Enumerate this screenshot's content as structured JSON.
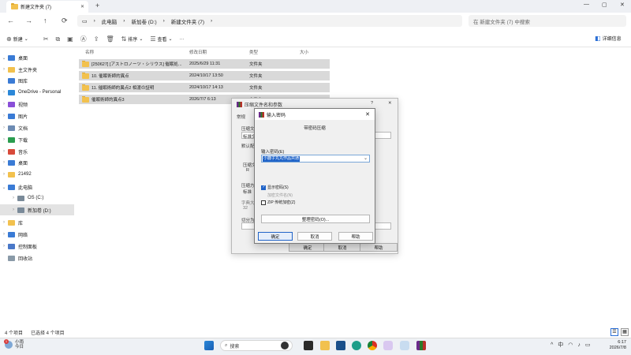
{
  "window": {
    "tab_title": "新建文件夹 (7)",
    "tab_close": "✕",
    "new_tab": "+",
    "min": "—",
    "max": "▢",
    "close": "✕"
  },
  "nav": {
    "back": "←",
    "forward": "→",
    "up": "↑",
    "refresh": "⟳",
    "breadcrumb": [
      "此电脑",
      "新加卷 (D:)",
      "新建文件夹 (7)"
    ],
    "search_placeholder": "在 新建文件夹 (7) 中搜索"
  },
  "toolbar": {
    "new_label": "新建",
    "sort_label": "排序",
    "view_label": "查看",
    "more_label": "···",
    "details_label": "详细信息"
  },
  "sidebar": {
    "items": [
      {
        "label": "桌面",
        "color": "#3a7bd5"
      },
      {
        "label": "主文件夹",
        "color": "#f2c14e"
      },
      {
        "label": "图库",
        "color": "#3a7bd5"
      },
      {
        "label": "OneDrive - Personal",
        "color": "#2b88d8"
      },
      {
        "label": "视频",
        "color": "#8a4fd8"
      },
      {
        "label": "图片",
        "color": "#3a7bd5"
      },
      {
        "label": "文档",
        "color": "#6d8bb3"
      },
      {
        "label": "下载",
        "color": "#2a9d4f"
      },
      {
        "label": "音乐",
        "color": "#d84a3a"
      },
      {
        "label": "桌面",
        "color": "#3a7bd5"
      },
      {
        "label": "21492",
        "color": "#f2c14e"
      },
      {
        "label": "此电脑",
        "color": "#3a7bd5"
      },
      {
        "label": "OS (C:)",
        "color": "#7a8a99"
      },
      {
        "label": "新加卷 (D:)",
        "color": "#7a8a99"
      },
      {
        "label": "库",
        "color": "#f2c14e"
      },
      {
        "label": "网络",
        "color": "#3a7bd5"
      },
      {
        "label": "控制面板",
        "color": "#4a78c8"
      },
      {
        "label": "回收站",
        "color": "#8a9aa8"
      }
    ]
  },
  "files": {
    "columns": [
      "名称",
      "修改日期",
      "类型",
      "大小"
    ],
    "rows": [
      {
        "name": "[250627] [アストロノーツ・シリウス] 催眠処...",
        "date": "2025/6/29 11:31",
        "type": "文件夹"
      },
      {
        "name": "10. 催眠術師的異点",
        "date": "2024/10/17 13:50",
        "type": "文件夹"
      },
      {
        "name": "11. 催眠術師的異点2 相渡の証明",
        "date": "2024/10/17 14:13",
        "type": "文件夹"
      },
      {
        "name": "催眠術師的異点3",
        "date": "2026/7/7 6:13",
        "type": "文件夹"
      }
    ]
  },
  "bg_dialog": {
    "title": "压缩文件名和参数",
    "help": "?",
    "close": "✕",
    "tab": "常规",
    "l1": "压缩文件名",
    "l2": "标准文",
    "l3": "默认配置",
    "l4": "压缩文",
    "l5": "压缩方式",
    "l6": "标准",
    "l7": "字典大小",
    "l8": "32",
    "l9": "切分为",
    "radio": "R",
    "ok": "确定",
    "cancel": "取消",
    "helpbtn": "帮助"
  },
  "pw_dialog": {
    "title": "输入密码",
    "close": "✕",
    "heading": "带密码压缩",
    "input_label": "输入密码(E)",
    "input_value": "小鹿子丸丸作品共通",
    "cb_show": "显示密码(S)",
    "cb_encrypt_names": "加密文件名(N)",
    "cb_zip": "ZIP 传统加密(Z)",
    "manage": "整理密码(O)...",
    "ok": "确定",
    "cancel": "取消",
    "help": "帮助"
  },
  "status": {
    "count": "4 个项目",
    "selected": "已选择 4 个项目"
  },
  "taskbar": {
    "weather_temp": "小雨",
    "weather_day": "今日",
    "weather_badge": "1",
    "search_label": "搜索",
    "tray_up": "^",
    "ime": "中",
    "clock_time": "6:17",
    "clock_date": "2026/7/8"
  }
}
